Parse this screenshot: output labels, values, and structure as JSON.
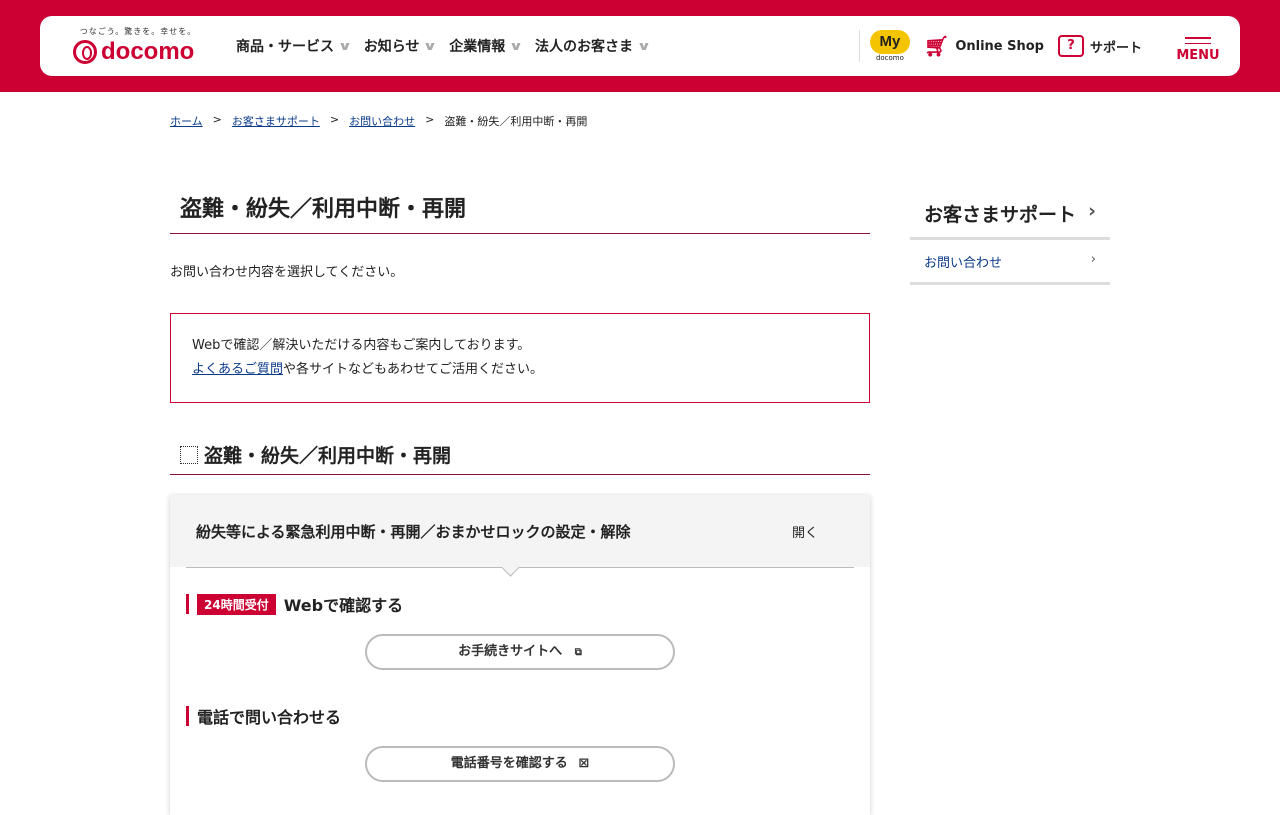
{
  "header": {
    "tagline": "つなごう。驚きを。幸せを。",
    "brand": "docomo",
    "nav": [
      "商品・サービス",
      "お知らせ",
      "企業情報",
      "法人のお客さま"
    ],
    "my": "My",
    "my_sub": "docomo",
    "shop": "Online Shop",
    "support": "サポート",
    "menu": "MENU",
    "brand_color": "#cc0033"
  },
  "breadcrumb": [
    "ホーム",
    "お客さまサポート",
    "お問い合わせ",
    "盗難・紛失／利用中断・再開"
  ],
  "main": {
    "title": "盗難・紛失／利用中断・再開",
    "lead": "お問い合わせ内容を選択してください。",
    "info_line1": "Webで確認／解決いただける内容もご案内しております。",
    "info_link": "よくあるご質問",
    "info_rest": "や各サイトなどもあわせてご活用ください。",
    "section_title": "盗難・紛失／利用中断・再開",
    "accordion": {
      "title": "紛失等による緊急利用中断・再開／おまかせロックの設定・解除",
      "toggle": "開く",
      "web_badge": "24時間受付",
      "web_heading": "Webで確認する",
      "web_button": "お手続きサイトへ",
      "phone_heading": "電話で問い合わせる",
      "phone_button": "電話番号を確認する"
    }
  },
  "sidebar": {
    "title": "お客さまサポート",
    "items": [
      "お問い合わせ"
    ]
  }
}
